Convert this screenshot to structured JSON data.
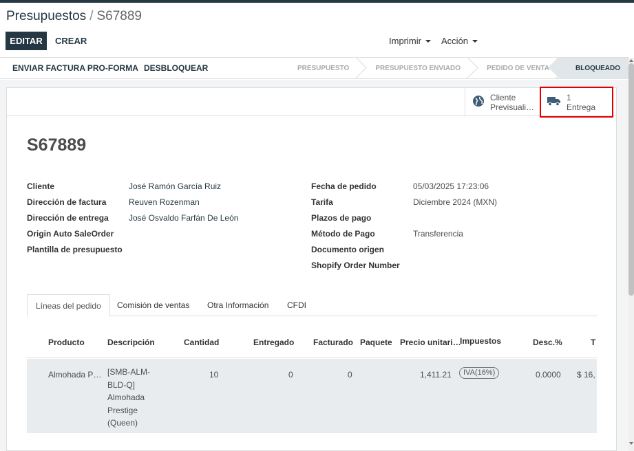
{
  "breadcrumb": {
    "parent": "Presupuestos",
    "separator": "/",
    "current": "S67889"
  },
  "toolbar": {
    "edit_label": "EDITAR",
    "create_label": "CREAR",
    "print_label": "Imprimir",
    "action_label": "Acción"
  },
  "statusbar": {
    "buttons": [
      "ENVIAR FACTURA PRO-FORMA",
      "DESBLOQUEAR"
    ],
    "stages": [
      "PRESUPUESTO",
      "PRESUPUESTO ENVIADO",
      "PEDIDO DE VENTA",
      "BLOQUEADO"
    ],
    "active_stage": "BLOQUEADO"
  },
  "smart_buttons": {
    "customer_preview": {
      "line1": "Cliente",
      "line2": "Previsuali…",
      "icon": "globe-icon"
    },
    "delivery": {
      "count": "1",
      "label": "Entrega",
      "icon": "truck-icon"
    }
  },
  "document": {
    "name": "S67889"
  },
  "fields_left": [
    {
      "label": "Cliente",
      "value": "José Ramón García Ruiz"
    },
    {
      "label": "Dirección de factura",
      "value": "Reuven Rozenman"
    },
    {
      "label": "Dirección de entrega",
      "value": "José Osvaldo Farfán De León"
    },
    {
      "label": "Origin Auto SaleOrder",
      "value": ""
    },
    {
      "label": "Plantilla de presupuesto",
      "value": ""
    }
  ],
  "fields_right": [
    {
      "label": "Fecha de pedido",
      "value": "05/03/2025 17:23:06"
    },
    {
      "label": "Tarifa",
      "value": "Diciembre 2024 (MXN)"
    },
    {
      "label": "Plazos de pago",
      "value": ""
    },
    {
      "label": "Método de Pago",
      "value": "Transferencia"
    },
    {
      "label": "Documento origen",
      "value": ""
    },
    {
      "label": "Shopify Order Number",
      "value": ""
    }
  ],
  "tabs": [
    "Líneas del pedido",
    "Comisión de ventas",
    "Otra Información",
    "CFDI"
  ],
  "order_lines": {
    "columns": [
      "Producto",
      "Descripción",
      "Cantidad",
      "Entregado",
      "Facturado",
      "Paquete",
      "Precio unitari…",
      "Impuestos",
      "Desc.%",
      "T"
    ],
    "rows": [
      {
        "product": "Almohada P…",
        "description_lines": [
          "[SMB-ALM-",
          "BLD-Q]",
          "Almohada",
          "Prestige",
          "(Queen)"
        ],
        "quantity": "10",
        "delivered": "0",
        "invoiced": "0",
        "package": "",
        "unit_price": "1,411.21",
        "taxes": "IVA(16%)",
        "discount": "0.0000",
        "total": "$ 16,"
      }
    ]
  }
}
